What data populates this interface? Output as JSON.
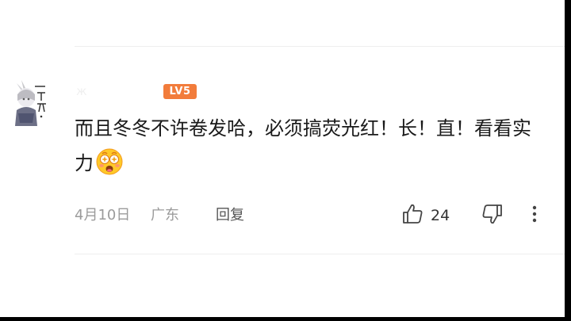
{
  "comment": {
    "username": "ж",
    "level": "LV5",
    "text": "而且冬冬不许卷发哈，必须搞荧光红！长！直！看看实力",
    "date": "4月10日",
    "location": "广东",
    "reply_label": "回复",
    "like_count": "24"
  },
  "colors": {
    "level_badge": "#f27c3b",
    "comment_text": "#1a1a1a",
    "meta_text": "#9b9b9b"
  },
  "icons": {
    "like": "thumbs-up-icon",
    "dislike": "thumbs-down-icon",
    "more": "more-vertical-icon",
    "emoji": "star-eyes-emoji-icon"
  }
}
